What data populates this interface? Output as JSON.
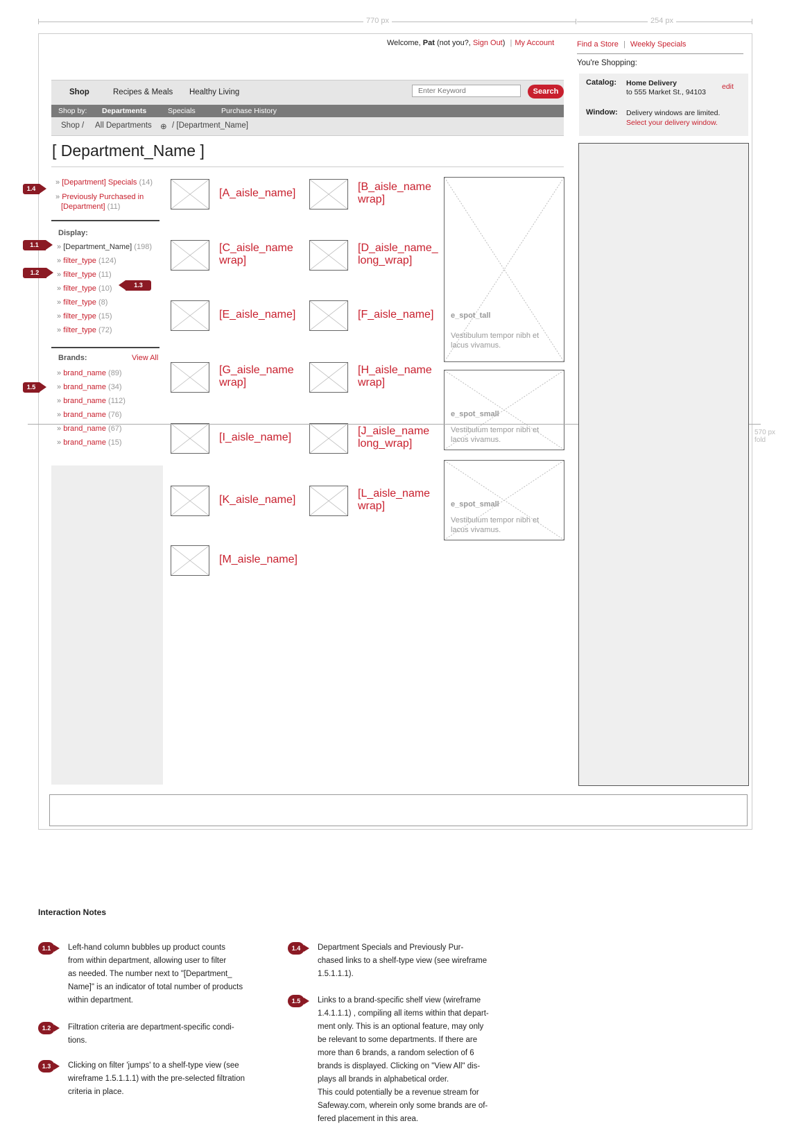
{
  "dimensions": {
    "main_width": "770 px",
    "rail_width": "254 px",
    "fold": "570 px\nfold"
  },
  "header": {
    "welcome": "Welcome, ",
    "user": "Pat",
    "not_you": " (not you?, ",
    "sign_out": "Sign Out",
    "close_paren": ")",
    "sep": "|",
    "my_account": "My Account",
    "find_store": "Find a Store",
    "weekly_specials": "Weekly Specials",
    "youre_shopping": "You're Shopping:"
  },
  "nav": {
    "items": [
      "Shop",
      "Recipes & Meals",
      "Healthy Living"
    ],
    "search_placeholder": "Enter Keyword",
    "search_label": "Search",
    "shop_by": "Shop by:",
    "sub_items": [
      "Departments",
      "Specials",
      "Purchase History"
    ],
    "breadcrumb": {
      "shop": "Shop  /",
      "all_depts": "All Departments",
      "plus_icon": "⊕",
      "current": "/  [Department_Name]"
    }
  },
  "page_title": "[ Department_Name ]",
  "left": {
    "specials": {
      "label": "[Department] Specials",
      "count": "(14)"
    },
    "prev_purchased": {
      "line1": "Previously Purchased in",
      "line2": "[Department]",
      "count": "(11)"
    },
    "display_label": "Display:",
    "display_items": [
      {
        "label": "[Department_Name]",
        "count": "(198)"
      },
      {
        "label": "filter_type",
        "count": "(124)"
      },
      {
        "label": "filter_type",
        "count": "(11)"
      },
      {
        "label": "filter_type",
        "count": "(10)"
      },
      {
        "label": "filter_type",
        "count": "(8)"
      },
      {
        "label": "filter_type",
        "count": "(15)"
      },
      {
        "label": "filter_type",
        "count": "(72)"
      }
    ],
    "brands_label": "Brands:",
    "view_all": "View All",
    "brands": [
      {
        "label": "brand_name",
        "count": "(89)"
      },
      {
        "label": "brand_name",
        "count": "(34)"
      },
      {
        "label": "brand_name",
        "count": "(112)"
      },
      {
        "label": "brand_name",
        "count": "(76)"
      },
      {
        "label": "brand_name",
        "count": "(67)"
      },
      {
        "label": "brand_name",
        "count": "(15)"
      }
    ]
  },
  "callouts": {
    "c11": "1.1",
    "c12": "1.2",
    "c13": "1.3",
    "c14": "1.4",
    "c15": "1.5"
  },
  "aisles": [
    "[A_aisle_name]",
    "[B_aisle_name wrap]",
    "[C_aisle_name wrap]",
    "[D_aisle_name_ long_wrap]",
    "[E_aisle_name]",
    "[F_aisle_name]",
    "[G_aisle_name wrap]",
    "[H_aisle_name wrap]",
    "[I_aisle_name]",
    "[J_aisle_name long_wrap]",
    "[K_aisle_name]",
    "[L_aisle_name wrap]",
    "[M_aisle_name]"
  ],
  "espots": {
    "tall": {
      "title": "e_spot_tall",
      "body": "Vestibulum tempor nibh et lacus vivamus."
    },
    "small1": {
      "title": "e_spot_small",
      "body": "Vestibulum tempor nibh et lacus vivamus."
    },
    "small2": {
      "title": "e_spot_small",
      "body": "Vestibulum tempor nibh et lacus vivamus."
    }
  },
  "right": {
    "catalog_label": "Catalog:",
    "catalog_value": "Home Delivery",
    "catalog_address": "to 555 Market St., 94103",
    "edit": "edit",
    "window_label": "Window:",
    "window_text": "Delivery windows are limited.",
    "window_link": "Select your delivery window."
  },
  "notes": {
    "title": "Interaction Notes",
    "items": [
      {
        "num": "1.1",
        "text": "Left-hand column bubbles up product counts\nfrom within department, allowing user to filter\nas needed. The number next to \"[Department_\nName]\" is an indicator of total number of products\nwithin department."
      },
      {
        "num": "1.2",
        "text": "Filtration criteria are department-specific condi-\ntions."
      },
      {
        "num": "1.3",
        "text": "Clicking on filter 'jumps' to a shelf-type view (see\nwireframe 1.5.1.1.1) with the pre-selected filtration\ncriteria in place."
      },
      {
        "num": "1.4",
        "text": "Department Specials and Previously Pur-\nchased links to a shelf-type view (see wireframe\n1.5.1.1.1)."
      },
      {
        "num": "1.5",
        "text": "Links to a brand-specific shelf view (wireframe\n1.4.1.1.1) , compiling all items within that depart-\nment only.  This is an optional feature, may only\nbe relevant to some departments.  If there are\nmore than 6 brands, a random selection of 6\nbrands is displayed.  Clicking on \"View All\" dis-\nplays all brands in alphabetical order.\nThis could potentially be a revenue stream for\nSafeway.com, wherein only some brands are of-\nfered placement in this area."
      }
    ]
  },
  "colors": {
    "accent": "#c8202e",
    "callout": "#8b1a24",
    "nav_bg": "#e6e6e6",
    "subnav_bg": "#7a7a7a"
  }
}
